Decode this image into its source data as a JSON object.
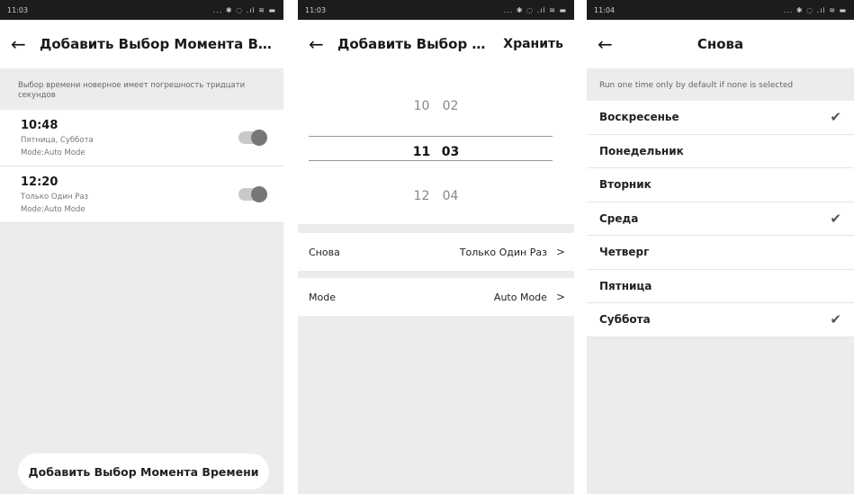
{
  "screen1": {
    "status": {
      "time": "11:03",
      "icons": "... ✱ ◌ .ıl ≋ ▬"
    },
    "header": {
      "title": "Добавить Выбор Момента Вре..."
    },
    "notice": "Выбор времени новерное имеет погрешность тридцати секундов",
    "alarms": [
      {
        "time": "10:48",
        "days": "Пятница, Суббота",
        "mode": "Mode:Auto Mode",
        "enabled": true
      },
      {
        "time": "12:20",
        "days": "Только Один Раз",
        "mode": "Mode:Auto Mode",
        "enabled": true
      }
    ],
    "add_button": "Добавить Выбор Момента Времени"
  },
  "screen2": {
    "status": {
      "time": "11:03",
      "icons": "... ✱ ◌ .ıl ≋ ▬"
    },
    "header": {
      "title": "Добавить Выбор Мо...",
      "save": "Хранить"
    },
    "picker": {
      "rows": [
        {
          "hour": "10",
          "minute": "02"
        },
        {
          "hour": "11",
          "minute": "03"
        },
        {
          "hour": "12",
          "minute": "04"
        }
      ]
    },
    "repeat": {
      "label": "Снова",
      "value": "Только Один Раз"
    },
    "mode": {
      "label": "Mode",
      "value": "Auto Mode"
    }
  },
  "screen3": {
    "status": {
      "time": "11:04",
      "icons": "... ✱ ◌ .ıl ≋ ▬"
    },
    "header": {
      "title": "Снова"
    },
    "hint": "Run one time only by default if none is selected",
    "days": [
      {
        "label": "Воскресенье",
        "checked": true
      },
      {
        "label": "Понедельник",
        "checked": false
      },
      {
        "label": "Вторник",
        "checked": false
      },
      {
        "label": "Среда",
        "checked": true
      },
      {
        "label": "Четверг",
        "checked": false
      },
      {
        "label": "Пятница",
        "checked": false
      },
      {
        "label": "Суббота",
        "checked": true
      }
    ]
  },
  "icons": {
    "back": "arrow-left-icon",
    "chevron": "chevron-right-icon",
    "check": "check-icon"
  }
}
